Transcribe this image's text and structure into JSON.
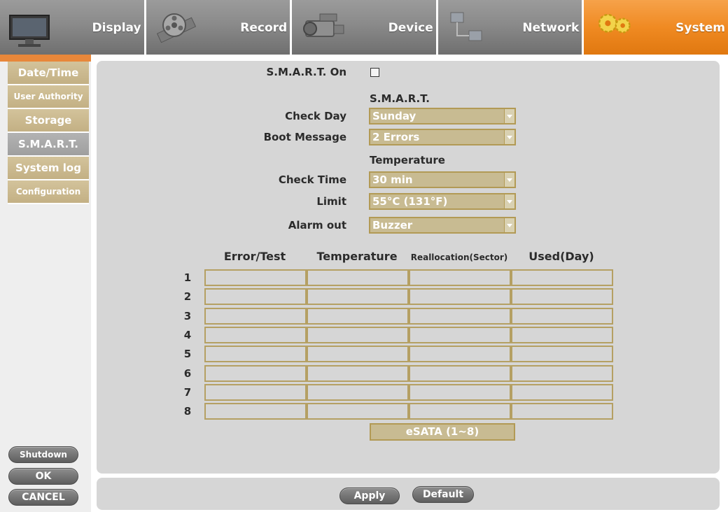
{
  "tabs": [
    {
      "label": "Display",
      "icon": "monitor-icon",
      "active": false
    },
    {
      "label": "Record",
      "icon": "film-reel-icon",
      "active": false
    },
    {
      "label": "Device",
      "icon": "camera-icon",
      "active": false
    },
    {
      "label": "Network",
      "icon": "network-icon",
      "active": false
    },
    {
      "label": "System",
      "icon": "gears-icon",
      "active": true
    }
  ],
  "sidebar": {
    "items": [
      {
        "label": "Date/Time"
      },
      {
        "label": "User Authority"
      },
      {
        "label": "Storage"
      },
      {
        "label": "S.M.A.R.T."
      },
      {
        "label": "System log"
      },
      {
        "label": "Configuration"
      }
    ],
    "active_index": 3,
    "shutdown_label": "Shutdown",
    "ok_label": "OK",
    "cancel_label": "CANCEL"
  },
  "smart": {
    "on_label": "S.M.A.R.T. On",
    "on_checked": false,
    "section_smart": "S.M.A.R.T.",
    "check_day_label": "Check Day",
    "check_day_value": "Sunday",
    "boot_message_label": "Boot Message",
    "boot_message_value": "2 Errors",
    "section_temperature": "Temperature",
    "check_time_label": "Check Time",
    "check_time_value": "30 min",
    "limit_label": "Limit",
    "limit_value": "55°C (131°F)",
    "alarm_out_label": "Alarm out",
    "alarm_out_value": "Buzzer"
  },
  "table": {
    "columns": [
      "Error/Test",
      "Temperature",
      "Reallocation(Sector)",
      "Used(Day)"
    ],
    "rows": [
      "1",
      "2",
      "3",
      "4",
      "5",
      "6",
      "7",
      "8"
    ]
  },
  "esata_label": "eSATA (1~8)",
  "footer": {
    "apply_label": "Apply",
    "default_label": "Default"
  },
  "colors": {
    "active_tab": "#f08a22",
    "tab_gray": "#8a8a8a",
    "menu_tan": "#c9b78a",
    "select_bg": "#c8bb92",
    "cell_border": "#b5a063",
    "panel_bg": "#d6d6d6"
  }
}
